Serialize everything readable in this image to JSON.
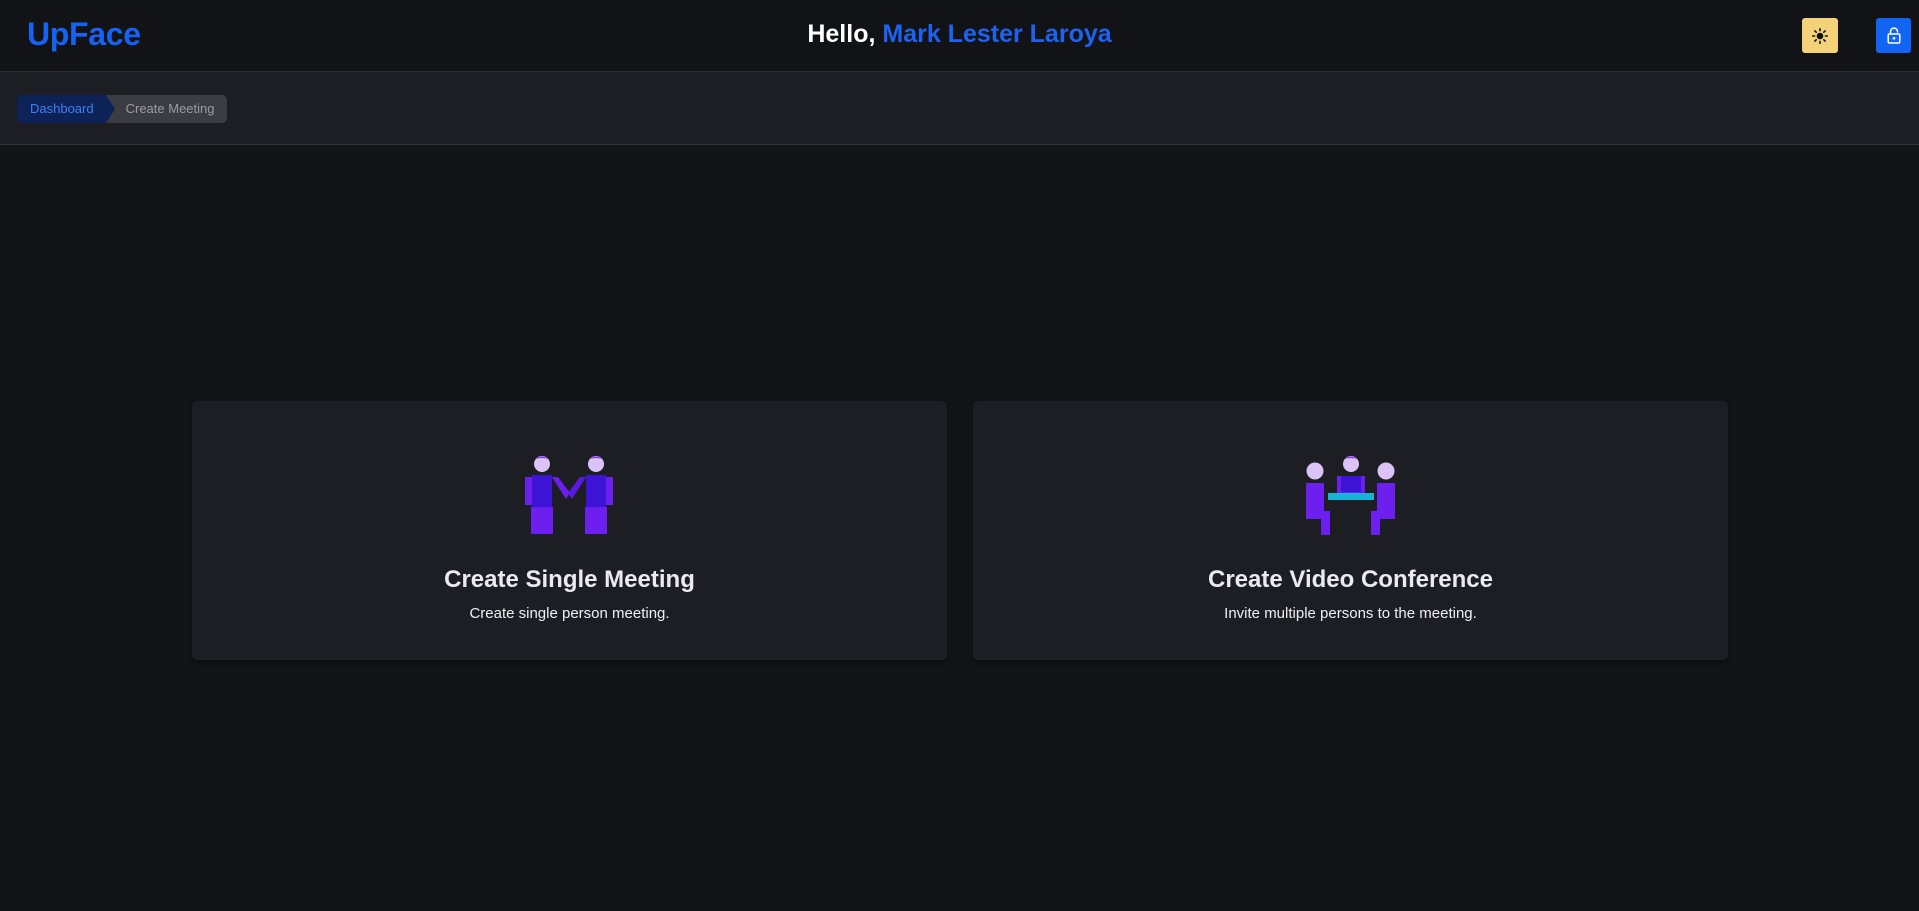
{
  "app": {
    "logo": "UpFace",
    "accent": "#1662f2"
  },
  "header": {
    "greeting": "Hello,",
    "user_name": "Mark Lester Laroya",
    "theme_toggle_icon": "sun-icon",
    "logout_icon": "lock-icon"
  },
  "breadcrumb": {
    "items": [
      "Dashboard",
      "Create Meeting"
    ]
  },
  "cards": [
    {
      "icon": "two-people-holding-hands-icon",
      "title": "Create Single Meeting",
      "description": "Create single person meeting."
    },
    {
      "icon": "meeting-around-table-icon",
      "title": "Create Video Conference",
      "description": "Invite multiple persons to the meeting."
    }
  ],
  "colors": {
    "background": "#131418",
    "panel": "#1d1e23",
    "theme_button": "#f3d27a",
    "lock_button": "#1264f5",
    "illustration_purple": "#6d1ff0",
    "illustration_dark": "#3d14d6",
    "illustration_head": "#dcc3f7",
    "illustration_table": "#16b4d8"
  }
}
